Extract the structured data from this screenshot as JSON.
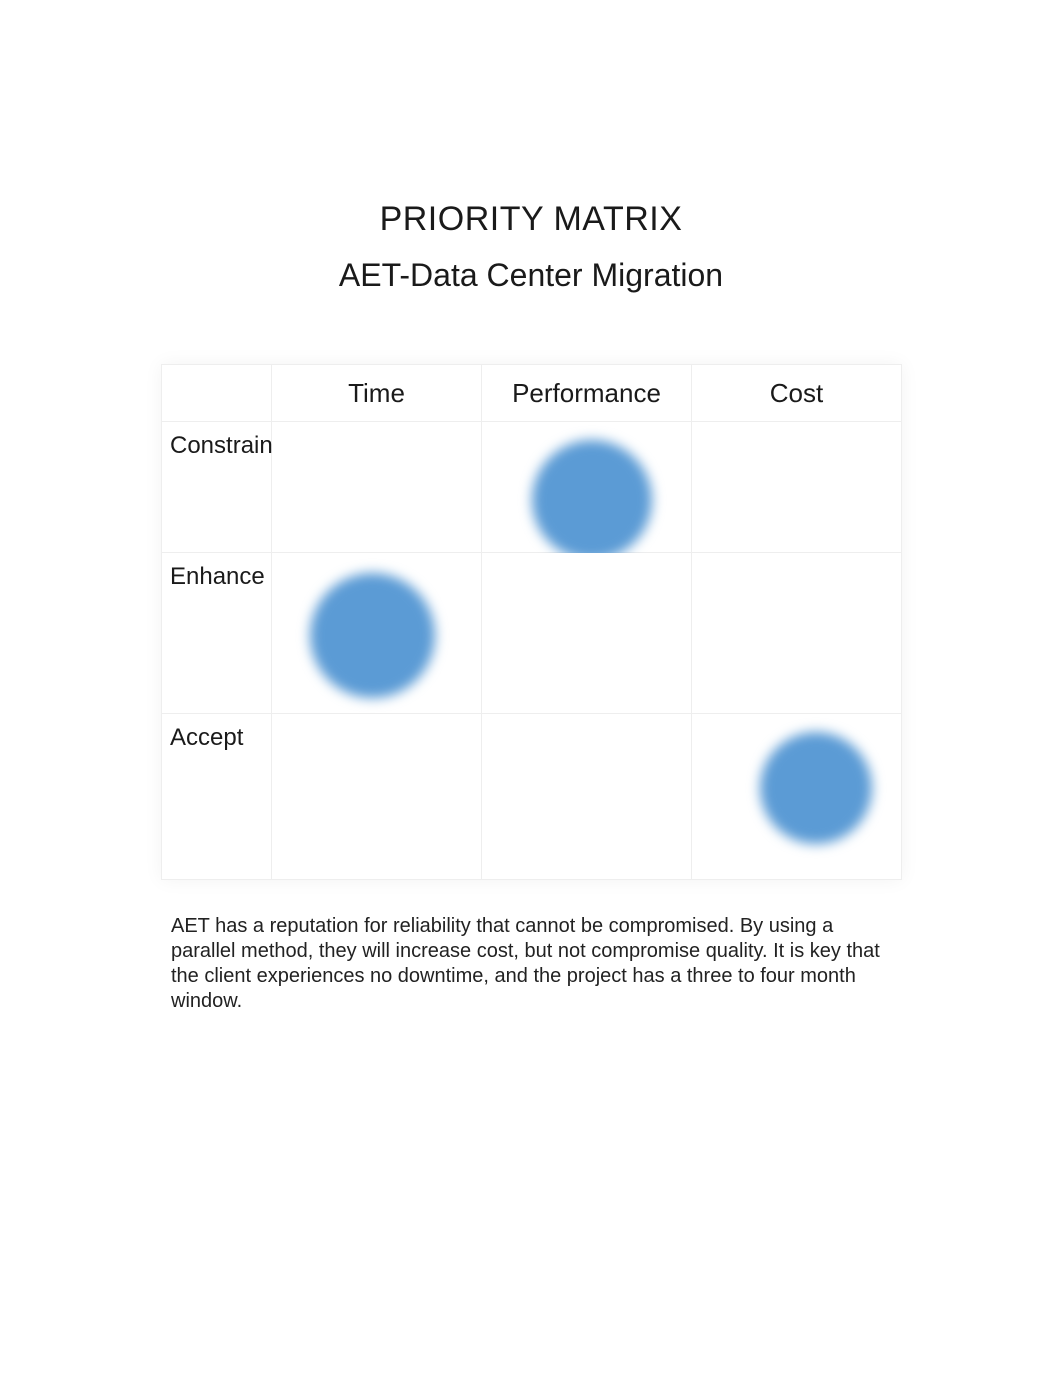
{
  "title": "PRIORITY MATRIX",
  "subtitle": "AET-Data Center Migration",
  "columns": [
    "Time",
    "Performance",
    "Cost"
  ],
  "rows": [
    "Constrain",
    "Enhance",
    "Accept"
  ],
  "caption": "AET has a reputation for reliability that cannot be compromised.  By using a parallel method, they will increase cost, but not compromise quality.  It is key that the client experiences no downtime, and the project has a three to four month window.",
  "chart_data": {
    "type": "table",
    "title": "Priority Matrix: AET-Data Center Migration",
    "row_labels": [
      "Constrain",
      "Enhance",
      "Accept"
    ],
    "column_labels": [
      "Time",
      "Performance",
      "Cost"
    ],
    "marks": [
      {
        "row": "Constrain",
        "column": "Performance",
        "value": true
      },
      {
        "row": "Enhance",
        "column": "Time",
        "value": true
      },
      {
        "row": "Accept",
        "column": "Cost",
        "value": true
      }
    ],
    "color": "#5B9BD5"
  }
}
